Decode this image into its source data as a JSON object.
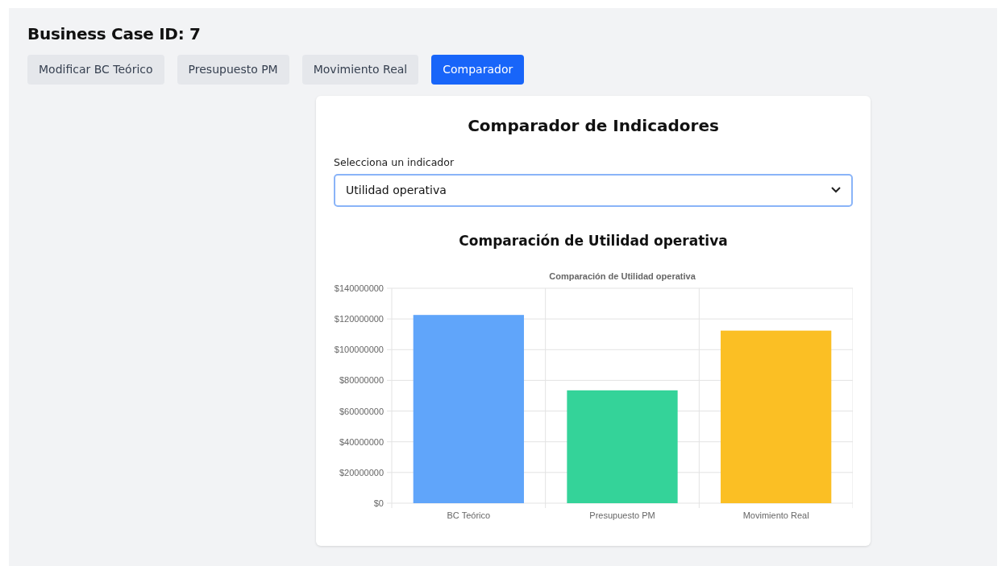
{
  "page": {
    "title": "Business Case ID: 7"
  },
  "tabs": [
    {
      "label": "Modificar BC Teórico",
      "selected": false
    },
    {
      "label": "Presupuesto PM",
      "selected": false
    },
    {
      "label": "Movimiento Real",
      "selected": false
    },
    {
      "label": "Comparador",
      "selected": true
    }
  ],
  "card": {
    "title": "Comparador de Indicadores",
    "select_label": "Selecciona un indicador",
    "select_value": "Utilidad operativa",
    "chart_heading": "Comparación de Utilidad operativa",
    "chart_data": {
      "type": "bar",
      "title": "Comparación de Utilidad operativa",
      "categories": [
        "BC Teórico",
        "Presupuesto PM",
        "Movimiento Real"
      ],
      "grid": true,
      "series": [
        {
          "colors": [
            "#60a5fa",
            "#34d399",
            "#fbbf24"
          ],
          "values": [
            122600000,
            73500000,
            112400000
          ]
        }
      ],
      "ylim": [
        0,
        140000000
      ],
      "yticks": [
        {
          "value": 0,
          "label": "$0"
        },
        {
          "value": 20000000,
          "label": "$20000000"
        },
        {
          "value": 40000000,
          "label": "$40000000"
        },
        {
          "value": 60000000,
          "label": "$60000000"
        },
        {
          "value": 80000000,
          "label": "$80000000"
        },
        {
          "value": 100000000,
          "label": "$100000000"
        },
        {
          "value": 120000000,
          "label": "$120000000"
        },
        {
          "value": 140000000,
          "label": "$140000000"
        }
      ]
    }
  }
}
